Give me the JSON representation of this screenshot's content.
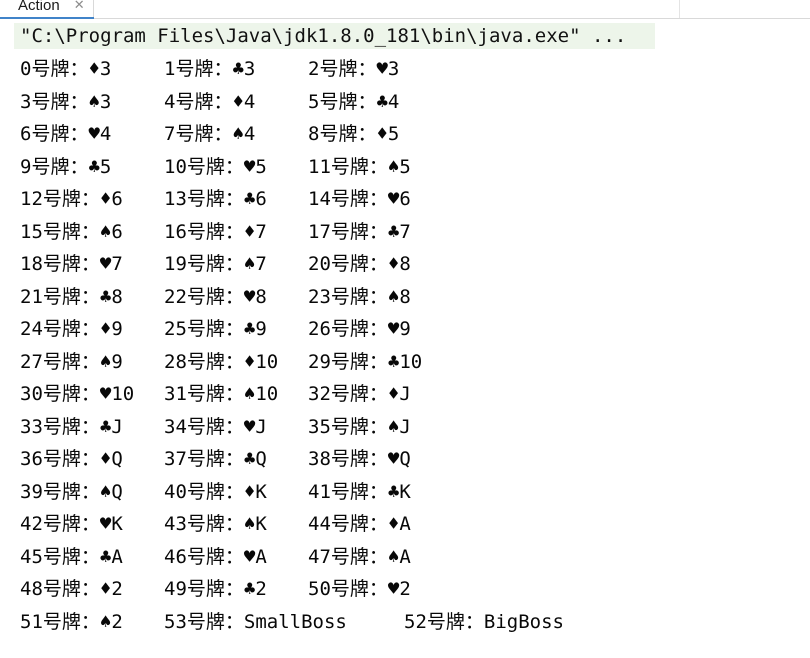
{
  "tab": {
    "label": "Action",
    "close": "✕"
  },
  "console": {
    "command": "\"C:\\Program Files\\Java\\jdk1.8.0_181\\bin\\java.exe\" ...",
    "rows": [
      [
        "0号牌：♦3",
        "1号牌：♣3",
        "2号牌：♥3"
      ],
      [
        "3号牌：♠3",
        "4号牌：♦4",
        "5号牌：♣4"
      ],
      [
        "6号牌：♥4",
        "7号牌：♠4",
        "8号牌：♦5"
      ],
      [
        "9号牌：♣5",
        "10号牌：♥5",
        "11号牌：♠5"
      ],
      [
        "12号牌：♦6",
        "13号牌：♣6",
        "14号牌：♥6"
      ],
      [
        "15号牌：♠6",
        "16号牌：♦7",
        "17号牌：♣7"
      ],
      [
        "18号牌：♥7",
        "19号牌：♠7",
        "20号牌：♦8"
      ],
      [
        "21号牌：♣8",
        "22号牌：♥8",
        "23号牌：♠8"
      ],
      [
        "24号牌：♦9",
        "25号牌：♣9",
        "26号牌：♥9"
      ],
      [
        "27号牌：♠9",
        "28号牌：♦10",
        "29号牌：♣10"
      ],
      [
        "30号牌：♥10",
        "31号牌：♠10",
        "32号牌：♦J"
      ],
      [
        "33号牌：♣J",
        "34号牌：♥J",
        "35号牌：♠J"
      ],
      [
        "36号牌：♦Q",
        "37号牌：♣Q",
        "38号牌：♥Q"
      ],
      [
        "39号牌：♠Q",
        "40号牌：♦K",
        "41号牌：♣K"
      ],
      [
        "42号牌：♥K",
        "43号牌：♠K",
        "44号牌：♦A"
      ],
      [
        "45号牌：♣A",
        "46号牌：♥A",
        "47号牌：♠A"
      ],
      [
        "48号牌：♦2",
        "49号牌：♣2",
        "50号牌：♥2"
      ],
      [
        "51号牌：♠2",
        "53号牌：SmallBoss",
        "52号牌：BigBoss"
      ]
    ]
  }
}
